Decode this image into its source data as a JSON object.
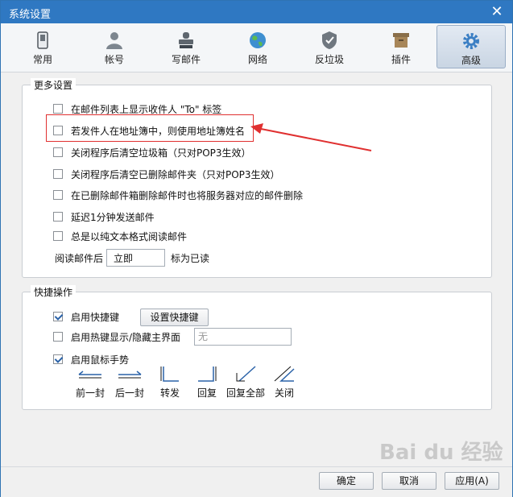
{
  "window": {
    "title": "系统设置"
  },
  "tabs": [
    {
      "label": "常用",
      "icon": "phone-icon"
    },
    {
      "label": "帐号",
      "icon": "user-icon"
    },
    {
      "label": "写邮件",
      "icon": "stamp-icon"
    },
    {
      "label": "网络",
      "icon": "globe-icon"
    },
    {
      "label": "反垃圾",
      "icon": "shield-icon"
    },
    {
      "label": "插件",
      "icon": "box-icon"
    },
    {
      "label": "高级",
      "icon": "gear-icon",
      "active": true
    }
  ],
  "more_settings": {
    "title": "更多设置",
    "options": [
      {
        "label": "在邮件列表上显示收件人 \"To\" 标签",
        "checked": false
      },
      {
        "label": "若发件人在地址簿中，则使用地址簿姓名",
        "checked": false
      },
      {
        "label": "关闭程序后清空垃圾箱（只对POP3生效）",
        "checked": false
      },
      {
        "label": "关闭程序后清空已删除邮件夹（只对POP3生效）",
        "checked": false
      },
      {
        "label": "在已删除邮件箱删除邮件时也将服务器对应的邮件删除",
        "checked": false
      },
      {
        "label": "延迟1分钟发送邮件",
        "checked": false
      },
      {
        "label": "总是以纯文本格式阅读邮件",
        "checked": false
      }
    ],
    "read_after_prefix": "阅读邮件后",
    "read_after_value": "立即",
    "read_after_suffix": "标为已读"
  },
  "shortcuts": {
    "title": "快捷操作",
    "enable_hotkeys": {
      "label": "启用快捷键",
      "checked": true
    },
    "set_hotkeys_button": "设置快捷键",
    "hotkey_toggle": {
      "label": "启用热键显示/隐藏主界面",
      "checked": false
    },
    "hotkey_value": "无",
    "mouse_gestures": {
      "label": "启用鼠标手势",
      "checked": true
    },
    "gestures": [
      "前一封",
      "后一封",
      "转发",
      "回复",
      "回复全部",
      "关闭"
    ]
  },
  "footer": {
    "ok": "确定",
    "cancel": "取消",
    "apply": "应用(A)"
  },
  "colors": {
    "titlebar": "#2f78c2",
    "annotation": "#e03030",
    "accent": "#2a62a8"
  }
}
